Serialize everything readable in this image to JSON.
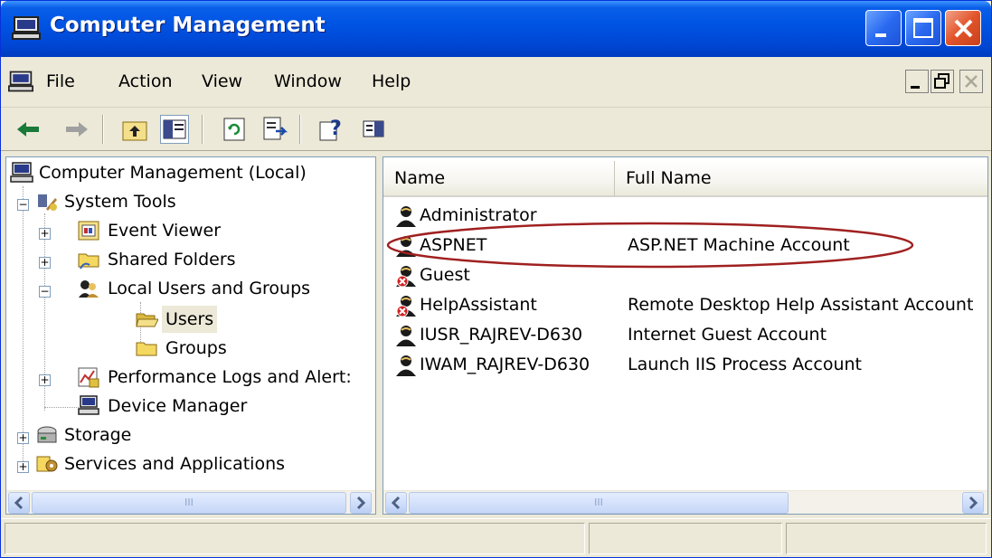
{
  "window": {
    "title": "Computer Management",
    "controls": {
      "minimize": "minimize",
      "maximize": "maximize",
      "close": "close"
    }
  },
  "menu": {
    "items": [
      "File",
      "Action",
      "View",
      "Window",
      "Help"
    ],
    "mdi": {
      "minimize": "_",
      "restore": "❐",
      "close": "×"
    }
  },
  "toolbar": {
    "buttons": [
      "back",
      "forward",
      "up-one-level",
      "show-hide-console-tree",
      "refresh",
      "export-list",
      "help",
      "show-hide-action-pane"
    ]
  },
  "tree": {
    "root": "Computer Management (Local)",
    "system_tools": "System Tools",
    "event_viewer": "Event Viewer",
    "shared_folders": "Shared Folders",
    "local_users_groups": "Local Users and Groups",
    "users": "Users",
    "groups": "Groups",
    "performance_logs": "Performance Logs and Alert:",
    "device_manager": "Device Manager",
    "storage": "Storage",
    "services_apps": "Services and Applications"
  },
  "list": {
    "headers": {
      "name": "Name",
      "full_name": "Full Name"
    },
    "rows": [
      {
        "name": "Administrator",
        "full_name": "",
        "disabled": false
      },
      {
        "name": "ASPNET",
        "full_name": "ASP.NET Machine Account",
        "disabled": false
      },
      {
        "name": "Guest",
        "full_name": "",
        "disabled": true
      },
      {
        "name": "HelpAssistant",
        "full_name": "Remote Desktop Help Assistant Account",
        "disabled": true
      },
      {
        "name": "IUSR_RAJREV-D630",
        "full_name": "Internet Guest Account",
        "disabled": false
      },
      {
        "name": "IWAM_RAJREV-D630",
        "full_name": "Launch IIS Process Account",
        "disabled": false
      }
    ]
  },
  "annotation": {
    "highlighted_row": "ASPNET",
    "color": "#a02020"
  },
  "colors": {
    "title_bar": "#0054e3",
    "selection_bg": "#ece9d8",
    "close_button": "#e2542a"
  }
}
